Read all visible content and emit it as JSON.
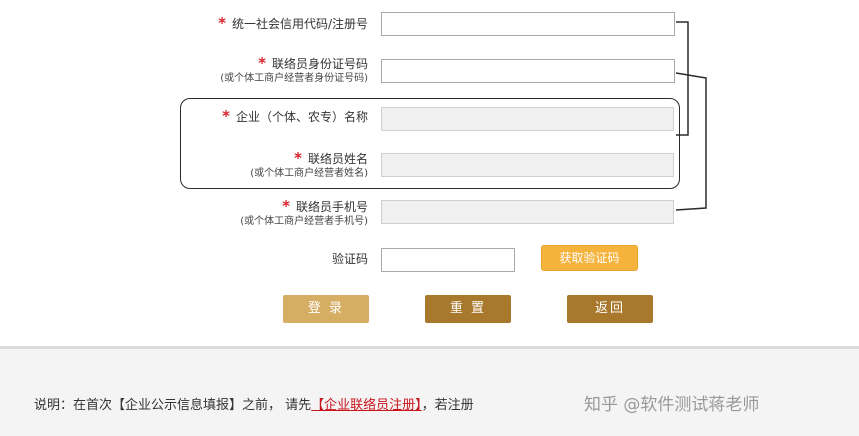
{
  "form": {
    "fields": [
      {
        "label": "统一社会信用代码/注册号",
        "sub": "",
        "value": ""
      },
      {
        "label": "联络员身份证号码",
        "sub": "(或个体工商户经营者身份证号码)",
        "value": ""
      },
      {
        "label": "企业（个体、农专）名称",
        "sub": "",
        "value": ""
      },
      {
        "label": "联络员姓名",
        "sub": "(或个体工商户经营者姓名)",
        "value": ""
      },
      {
        "label": "联络员手机号",
        "sub": "(或个体工商户经营者手机号)",
        "value": ""
      },
      {
        "label": "验证码",
        "sub": "",
        "value": ""
      }
    ],
    "required_mark": "*",
    "get_code_label": "获取验证码"
  },
  "buttons": {
    "login": "登 录",
    "reset": "重 置",
    "back": "返回"
  },
  "notice": {
    "text_before": "说明：在首次【企业公示信息填报】之前， 请先",
    "link": "【企业联络员注册】",
    "text_after": "，若注册"
  },
  "watermark": "知乎 @软件测试蒋老师",
  "colors": {
    "required": "#d9232d",
    "get_code_button": "#f5b33c",
    "login_button": "#d6ae63",
    "action_button": "#a8782c",
    "link": "#c9151e"
  }
}
